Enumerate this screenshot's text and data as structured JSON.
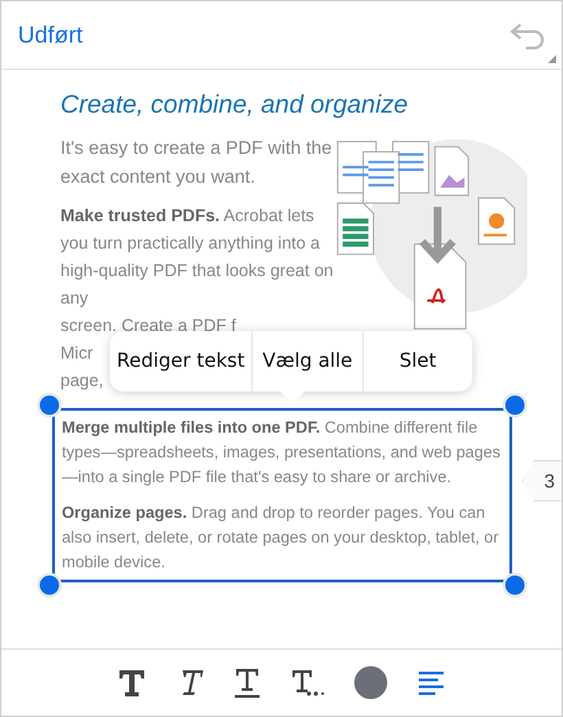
{
  "header": {
    "done_label": "Udført"
  },
  "document": {
    "heading": "Create, combine, and organize",
    "intro": "It's easy to create a PDF with the exact content you want.",
    "paragraph_1": "**Make trusted PDFs.** Acrobat lets you turn practically anything into a high-quality PDF that looks great on any",
    "paragraph_1_cut_lines": [
      "screen. Create a PDF f",
      "Micr",
      "page,"
    ],
    "selected_paragraphs": [
      "**Merge multiple files into one PDF.** Combine different file types—spreadsheets, images, presentations, and web pages—into a single PDF file that's easy to share or archive.",
      "**Organize pages.** Drag and drop to reorder pages. You can also insert, delete, or rotate pages on your desktop, tablet, or mobile device."
    ]
  },
  "context_menu": [
    "Rediger tekst",
    "Vælg alle",
    "Slet"
  ],
  "page_badge": "3"
}
